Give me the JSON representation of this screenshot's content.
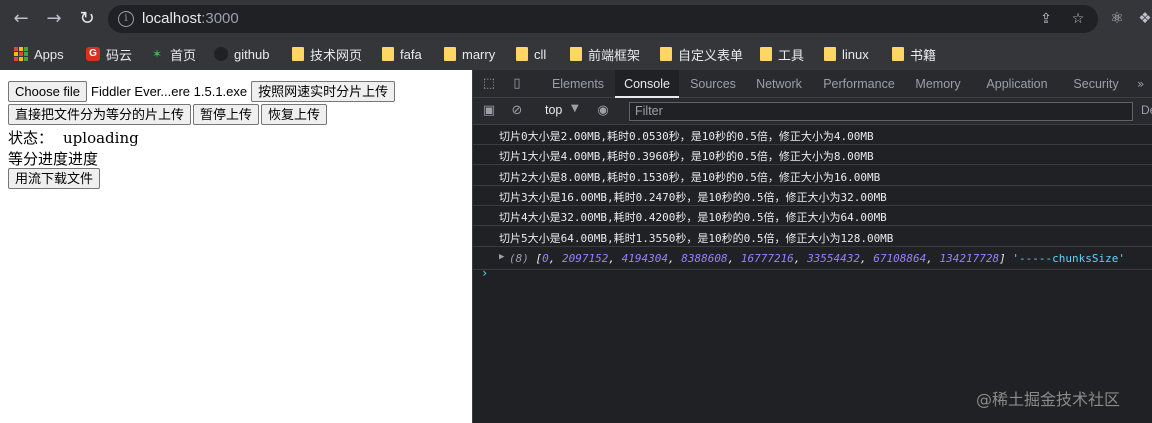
{
  "browser": {
    "url_host": "localhost",
    "url_port": ":3000",
    "bookmarks": [
      {
        "label": "Apps"
      },
      {
        "label": "码云"
      },
      {
        "label": "首页"
      },
      {
        "label": "github"
      },
      {
        "label": "技术网页"
      },
      {
        "label": "fafa"
      },
      {
        "label": "marry"
      },
      {
        "label": "cll"
      },
      {
        "label": "前端框架"
      },
      {
        "label": "自定义表单"
      },
      {
        "label": "工具"
      },
      {
        "label": "linux"
      },
      {
        "label": "书籍"
      }
    ]
  },
  "page": {
    "choose_file_label": "Choose file",
    "file_name": "Fiddler Ever...ere 1.5.1.exe",
    "realtime_upload_label": "按照网速实时分片上传",
    "equal_upload_label": "直接把文件分为等分的片上传",
    "pause_label": "暂停上传",
    "resume_label": "恢复上传",
    "status_label": "状态：",
    "status_value": "uploading",
    "progress_label": "等分进度进度",
    "stream_download_label": "用流下载文件"
  },
  "devtools": {
    "tabs": [
      "Elements",
      "Console",
      "Sources",
      "Network",
      "Performance",
      "Memory",
      "Application",
      "Security"
    ],
    "active_tab": "Console",
    "context": "top",
    "filter_placeholder": "Filter",
    "right_label": "De",
    "more": "»",
    "logs": [
      "切片0大小是2.00MB,耗时0.0530秒，是10秒的0.5倍，修正大小为4.00MB",
      "切片1大小是4.00MB,耗时0.3960秒，是10秒的0.5倍，修正大小为8.00MB",
      "切片2大小是8.00MB,耗时0.1530秒，是10秒的0.5倍，修正大小为16.00MB",
      "切片3大小是16.00MB,耗时0.2470秒，是10秒的0.5倍，修正大小为32.00MB",
      "切片4大小是32.00MB,耗时0.4200秒，是10秒的0.5倍，修正大小为64.00MB",
      "切片5大小是64.00MB,耗时1.3550秒，是10秒的0.5倍，修正大小为128.00MB"
    ],
    "array_count": "(8)",
    "array_values": [
      "0",
      "2097152",
      "4194304",
      "8388608",
      "16777216",
      "33554432",
      "67108864",
      "134217728"
    ],
    "array_string": "'-----chunksSize'",
    "prompt": "›"
  },
  "watermark": "@稀土掘金技术社区"
}
